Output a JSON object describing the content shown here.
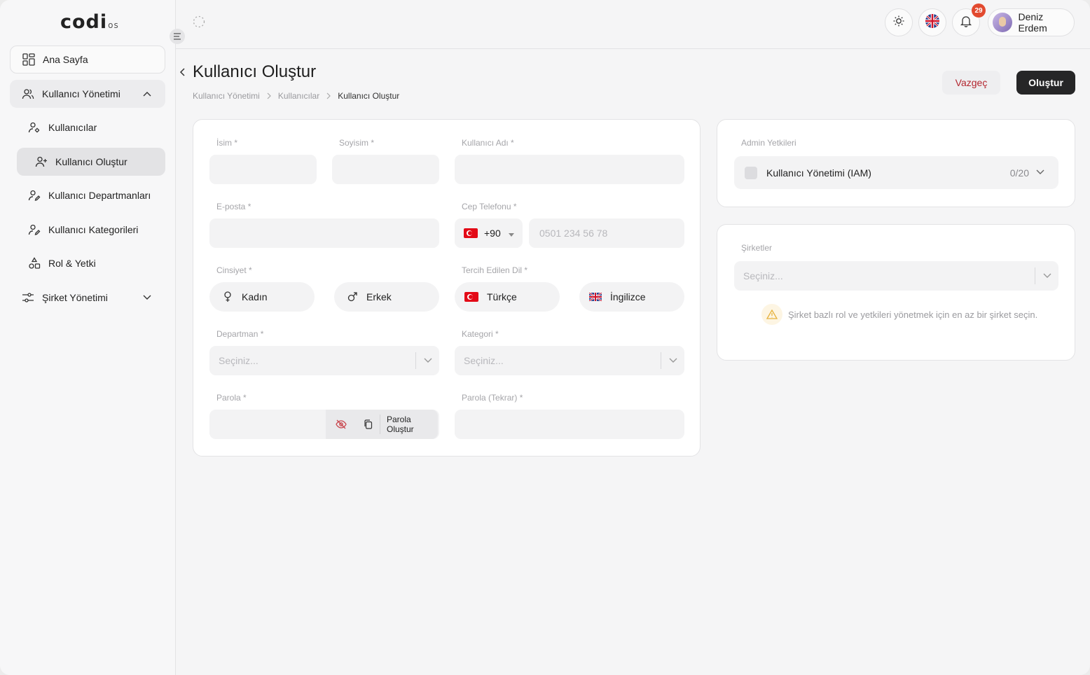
{
  "brand": {
    "logo_main": "codi",
    "logo_suffix": "os"
  },
  "sidebar": {
    "items": [
      {
        "label": "Ana Sayfa"
      },
      {
        "label": "Kullanıcı Yönetimi"
      },
      {
        "label": "Kullanıcılar"
      },
      {
        "label": "Kullanıcı Oluştur"
      },
      {
        "label": "Kullanıcı Departmanları"
      },
      {
        "label": "Kullanıcı Kategorileri"
      },
      {
        "label": "Rol & Yetki"
      },
      {
        "label": "Şirket Yönetimi"
      }
    ]
  },
  "topbar": {
    "notification_count": "29",
    "user_name": "Deniz Erdem"
  },
  "page": {
    "title": "Kullanıcı Oluştur",
    "breadcrumb": [
      "Kullanıcı Yönetimi",
      "Kullanıcılar",
      "Kullanıcı Oluştur"
    ],
    "cancel_label": "Vazgeç",
    "create_label": "Oluştur"
  },
  "form": {
    "first_name_label": "İsim *",
    "last_name_label": "Soyisim *",
    "username_label": "Kullanıcı Adı *",
    "email_label": "E-posta *",
    "phone_label": "Cep Telefonu *",
    "phone_code": "+90",
    "phone_placeholder": "0501 234 56 78",
    "gender_label": "Cinsiyet *",
    "gender_female": "Kadın",
    "gender_male": "Erkek",
    "language_label": "Tercih Edilen Dil *",
    "language_tr": "Türkçe",
    "language_en": "İngilizce",
    "department_label": "Departman *",
    "department_placeholder": "Seçiniz...",
    "category_label": "Kategori *",
    "category_placeholder": "Seçiniz...",
    "password_label": "Parola *",
    "password_generate": "Parola Oluştur",
    "password_repeat_label": "Parola (Tekrar) *"
  },
  "admin_permissions": {
    "title": "Admin Yetkileri",
    "item_label": "Kullanıcı Yönetimi (IAM)",
    "item_count": "0/20"
  },
  "companies": {
    "title": "Şirketler",
    "placeholder": "Seçiniz...",
    "warning": "Şirket bazlı rol ve yetkileri yönetmek için en az bir şirket seçin."
  },
  "colors": {
    "accent_dark": "#262627",
    "cancel_text": "#b3262f",
    "badge": "#e24a2f"
  }
}
